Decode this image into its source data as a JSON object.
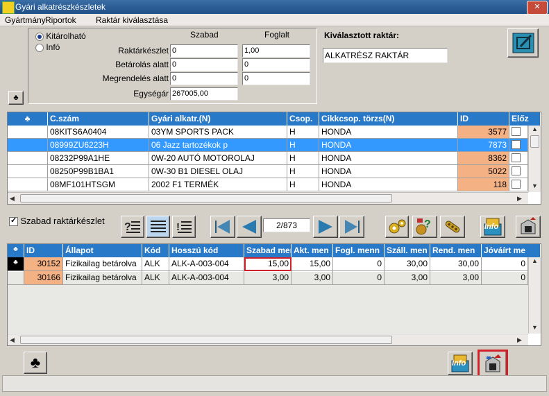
{
  "window": {
    "title": "Gyári alkatrészkészletek"
  },
  "menu": [
    "Gyártmány",
    "Riportok",
    "Raktár kiválasztása"
  ],
  "mode": {
    "options": [
      "Kitárolható",
      "Infó"
    ],
    "selected": "Kitárolható"
  },
  "stock_panel": {
    "col_headers": [
      "Szabad",
      "Foglalt"
    ],
    "rows": [
      {
        "label": "Raktárkészlet",
        "free": "0",
        "reserved": "1,00"
      },
      {
        "label": "Betárolás alatt",
        "free": "0",
        "reserved": "0"
      },
      {
        "label": "Megrendelés alatt",
        "free": "0",
        "reserved": "0"
      }
    ],
    "unit_price_label": "Egységár",
    "unit_price": "267005,00"
  },
  "warehouse": {
    "label": "Kiválasztott raktár:",
    "value": "ALKATRÉSZ RAKTÁR"
  },
  "parts_grid": {
    "headers": [
      "♣",
      "C.szám",
      "Gyári alkatr.(N)",
      "Csop.",
      "Cikkcsop. törzs(N)",
      "ID",
      "Előz"
    ],
    "rows": [
      {
        "cszam": "08KITS6A0404",
        "name": "03YM SPORTS PACK",
        "csop": "H",
        "torzs": "HONDA",
        "id": "3577"
      },
      {
        "cszam": "08999ZU6223H",
        "name": "06 Jazz tartozékok p",
        "csop": "H",
        "torzs": "HONDA",
        "id": "7873"
      },
      {
        "cszam": "08232P99A1HE",
        "name": "0W-20 AUTÓ MOTOROLAJ",
        "csop": "H",
        "torzs": "HONDA",
        "id": "8362"
      },
      {
        "cszam": "08250P99B1BA1",
        "name": "0W-30 B1 DIESEL OLAJ",
        "csop": "H",
        "torzs": "HONDA",
        "id": "5022"
      },
      {
        "cszam": "08MF101HTSGM",
        "name": "2002 F1 TERMÉK",
        "csop": "H",
        "torzs": "HONDA",
        "id": "118"
      }
    ],
    "selected_index": 1
  },
  "free_stock_checkbox": {
    "label": "Szabad raktárkészlet",
    "checked": true
  },
  "pager": {
    "text": "2/873"
  },
  "stock_grid": {
    "headers": [
      "♣",
      "ID",
      "Állapot",
      "Kód",
      "Hosszú kód",
      "Szabad men",
      "Akt. men",
      "Fogl. menn",
      "Száll. men",
      "Rend. men",
      "Jóváírt me"
    ],
    "rows": [
      {
        "id": "30152",
        "status": "Fizikailag betárolva",
        "kod": "ALK",
        "long": "ALK-A-003-004",
        "free": "15,00",
        "akt": "15,00",
        "fogl": "0",
        "szall": "30,00",
        "rend": "30,00",
        "jov": "0"
      },
      {
        "id": "30166",
        "status": "Fizikailag betárolva",
        "kod": "ALK",
        "long": "ALK-A-003-004",
        "free": "3,00",
        "akt": "3,00",
        "fogl": "0",
        "szall": "3,00",
        "rend": "3,00",
        "jov": "0"
      }
    ]
  },
  "icons": {
    "info_label": "Info"
  },
  "colors": {
    "header_blue": "#2979c9",
    "selection_blue": "#3399ff",
    "id_salmon": "#f4b183",
    "highlight_red": "#d0202a"
  }
}
